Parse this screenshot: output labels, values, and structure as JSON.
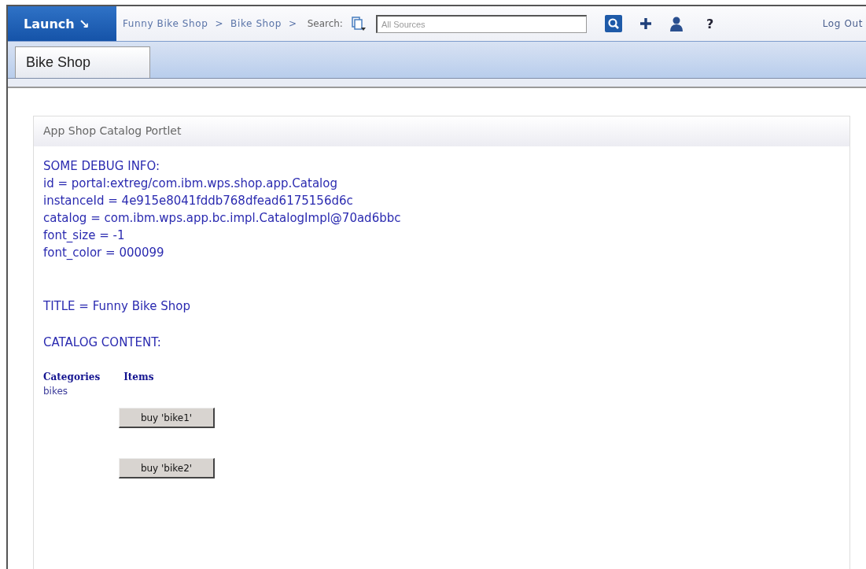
{
  "top_bar": {
    "launch": "Launch ↘",
    "breadcrumb": [
      "Funny Bike Shop",
      ">",
      "Bike Shop",
      ">"
    ],
    "search_label": "Search:",
    "search": {
      "placeholder": "All Sources"
    },
    "help": "?",
    "logout": "Log Out"
  },
  "tabs": [
    {
      "label": "Bike Shop",
      "selected": true
    }
  ],
  "portlet": {
    "title": "App Shop Catalog Portlet",
    "debug_lines": [
      "SOME DEBUG INFO:",
      "id = portal:extreg/com.ibm.wps.shop.app.Catalog",
      "instanceId = 4e915e8041fddb768dfead6175156d6c",
      "catalog = com.ibm.wps.app.bc.impl.CatalogImpl@70ad6bbc",
      "font_size = -1",
      "font_color = 000099"
    ],
    "title_line": "TITLE = Funny Bike Shop",
    "content_heading": "CATALOG CONTENT:",
    "table": {
      "columns": [
        "Categories",
        "Items"
      ],
      "category": "bikes",
      "buttons": [
        "buy 'bike1'",
        "buy 'bike2'"
      ]
    }
  }
}
